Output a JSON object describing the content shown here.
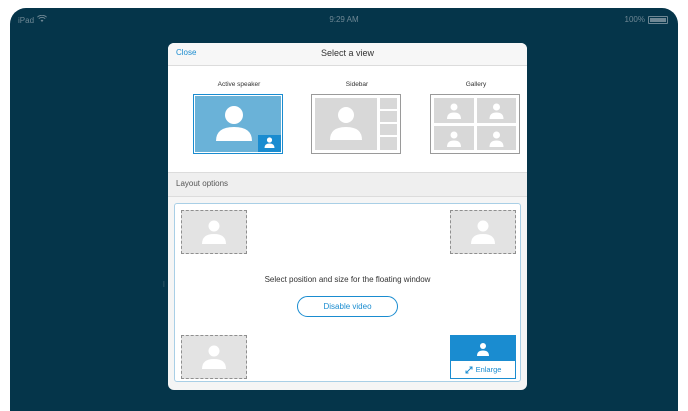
{
  "statusbar": {
    "device": "iPad",
    "time": "9:29 AM",
    "battery": "100%"
  },
  "background": {
    "text": "l"
  },
  "modal": {
    "close_label": "Close",
    "title": "Select a view",
    "views": [
      {
        "label": "Active speaker",
        "selected": true
      },
      {
        "label": "Sidebar",
        "selected": false
      },
      {
        "label": "Gallery",
        "selected": false
      }
    ],
    "section_label": "Layout options",
    "layout": {
      "instruction": "Select position and size for the floating window",
      "disable_video_label": "Disable video",
      "enlarge_label": "Enlarge"
    }
  },
  "colors": {
    "accent": "#1a8cd0",
    "screen_bg": "#05354a",
    "placeholder": "#e3e3e3"
  }
}
